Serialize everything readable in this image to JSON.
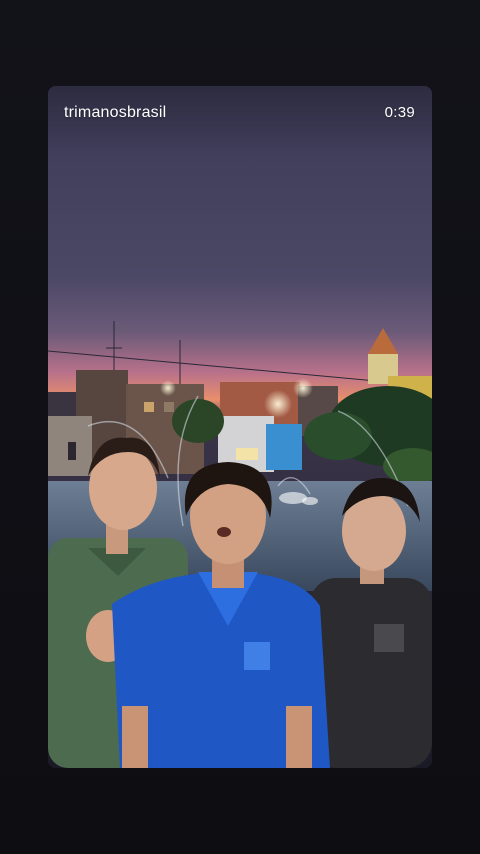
{
  "story": {
    "username": "trimanosbrasil",
    "time_remaining": "0:39"
  },
  "colors": {
    "page_background": "#0f0f14",
    "sky_top": "#3d3c55",
    "sky_horizon": "#f08a5c",
    "overlay_text": "#ffffff"
  },
  "icons": {
    "scene": "video-frame"
  }
}
